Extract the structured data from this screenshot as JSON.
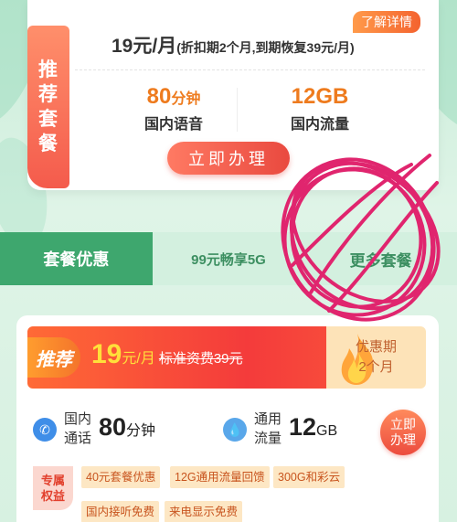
{
  "top_card": {
    "recommend_tag": [
      "推",
      "荐",
      "套",
      "餐"
    ],
    "detail_link": "了解详情",
    "price_main": "19元/月",
    "price_note": "(折扣期2个月,到期恢复39元/月)",
    "features": [
      {
        "value": "80",
        "unit": "分钟",
        "label": "国内语音"
      },
      {
        "value": "12GB",
        "unit": "",
        "label": "国内流量"
      }
    ],
    "apply_button": "立即办理"
  },
  "tabs": [
    "套餐优惠",
    "99元畅享5G",
    "更多套餐"
  ],
  "offer_card": {
    "badge": "推荐",
    "price": "19",
    "price_unit": "元/月",
    "standard_price": "标准资费39元",
    "period_label": "优惠期",
    "period_value": "2个月",
    "call": {
      "label": [
        "国内",
        "通话"
      ],
      "value": "80",
      "unit": "分钟"
    },
    "data": {
      "label": [
        "通用",
        "流量"
      ],
      "value": "12",
      "unit": "GB"
    },
    "apply_button": [
      "立即",
      "办理"
    ],
    "rights_tag": [
      "专属",
      "权益"
    ],
    "benefits": [
      "40元套餐优惠",
      "12G通用流量回馈",
      "300G和彩云",
      "国内接听免费",
      "来电显示免费"
    ]
  },
  "colors": {
    "accent_green": "#3ea76e",
    "accent_red": "#e9493f",
    "scribble": "#e0256e"
  }
}
